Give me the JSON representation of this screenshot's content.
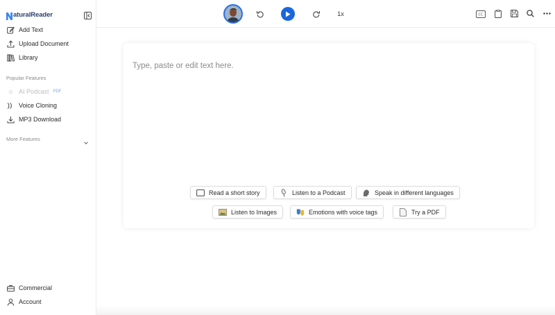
{
  "app": {
    "logo_text": "aturalReader",
    "logo_initial": "N"
  },
  "sidebar": {
    "primary": [
      {
        "label": "Add Text",
        "icon": "edit-icon"
      },
      {
        "label": "Upload Document",
        "icon": "upload-icon"
      },
      {
        "label": "Library",
        "icon": "library-icon"
      }
    ],
    "popular_label": "Popular Features",
    "popular": [
      {
        "label": "AI Podcast",
        "icon": "podcast-icon",
        "badge": "PDF",
        "disabled": true
      },
      {
        "label": "Voice Cloning",
        "icon": "voice-clone-icon"
      },
      {
        "label": "MP3 Download",
        "icon": "download-icon"
      }
    ],
    "more_label": "More Features",
    "footer": [
      {
        "label": "Commercial",
        "icon": "briefcase-icon"
      },
      {
        "label": "Account",
        "icon": "user-icon"
      }
    ]
  },
  "toolbar": {
    "speed": "1x",
    "right_icons": [
      "cc-icon",
      "clipboard-icon",
      "save-icon",
      "search-icon",
      "more-icon"
    ],
    "accent": "#1a66e0"
  },
  "editor": {
    "placeholder": "Type, paste or edit text here.",
    "suggestions": [
      {
        "label": "Read a short story",
        "icon": "book-icon"
      },
      {
        "label": "Listen to a Podcast",
        "icon": "microphone-icon"
      },
      {
        "label": "Speak in different languages",
        "icon": "speaking-head-icon"
      },
      {
        "label": "Listen to Images",
        "icon": "picture-icon"
      },
      {
        "label": "Emotions with voice tags",
        "icon": "theater-masks-icon"
      },
      {
        "label": "Try a PDF",
        "icon": "document-icon"
      }
    ]
  }
}
